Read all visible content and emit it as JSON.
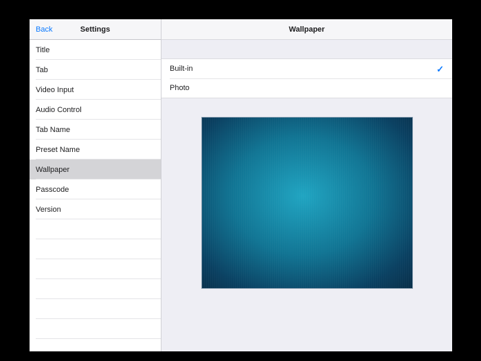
{
  "window": {
    "frame_color": "#000000"
  },
  "sidebar": {
    "back_label": "Back",
    "title": "Settings",
    "items": [
      {
        "label": "Title",
        "selected": false
      },
      {
        "label": "Tab",
        "selected": false
      },
      {
        "label": "Video Input",
        "selected": false
      },
      {
        "label": "Audio Control",
        "selected": false
      },
      {
        "label": "Tab Name",
        "selected": false
      },
      {
        "label": "Preset Name",
        "selected": false
      },
      {
        "label": "Wallpaper",
        "selected": true
      },
      {
        "label": "Passcode",
        "selected": false
      },
      {
        "label": "Version",
        "selected": false
      }
    ]
  },
  "detail": {
    "title": "Wallpaper",
    "options": [
      {
        "label": "Built-in",
        "selected": true
      },
      {
        "label": "Photo",
        "selected": false
      }
    ],
    "checkmark_glyph": "✓",
    "accent_color": "#0b7aff",
    "preview": {
      "description": "built-in wallpaper preview, teal radial gradient",
      "center_color": "#20a5c2",
      "mid_color": "#117594",
      "outer_color": "#0a4061",
      "edge_color": "#092e48"
    }
  }
}
